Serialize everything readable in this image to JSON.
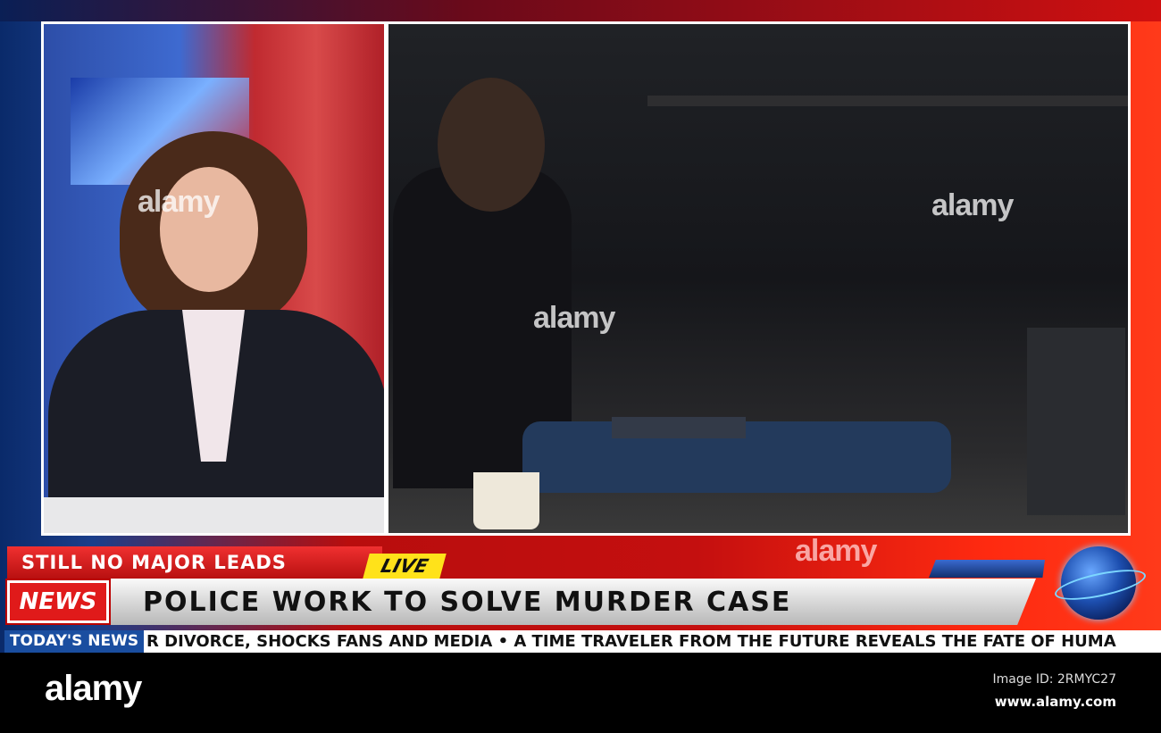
{
  "lower_third": {
    "subheadline": "STILL NO MAJOR LEADS",
    "live_badge": "LIVE",
    "news_badge": "NEWS",
    "headline": "POLICE WORK TO SOLVE MURDER CASE"
  },
  "ticker": {
    "label": "TODAY'S NEWS",
    "text": "R DIVORCE, SHOCKS FANS AND MEDIA • A TIME TRAVELER FROM THE FUTURE REVEALS THE FATE OF HUMA"
  },
  "watermark": "alamy",
  "footer": {
    "logo": "alamy",
    "image_id": "Image ID: 2RMYC27",
    "site": "www.alamy.com"
  },
  "colors": {
    "red": "#d01010",
    "yellow": "#ffe21a",
    "blue": "#1a4ea0"
  }
}
